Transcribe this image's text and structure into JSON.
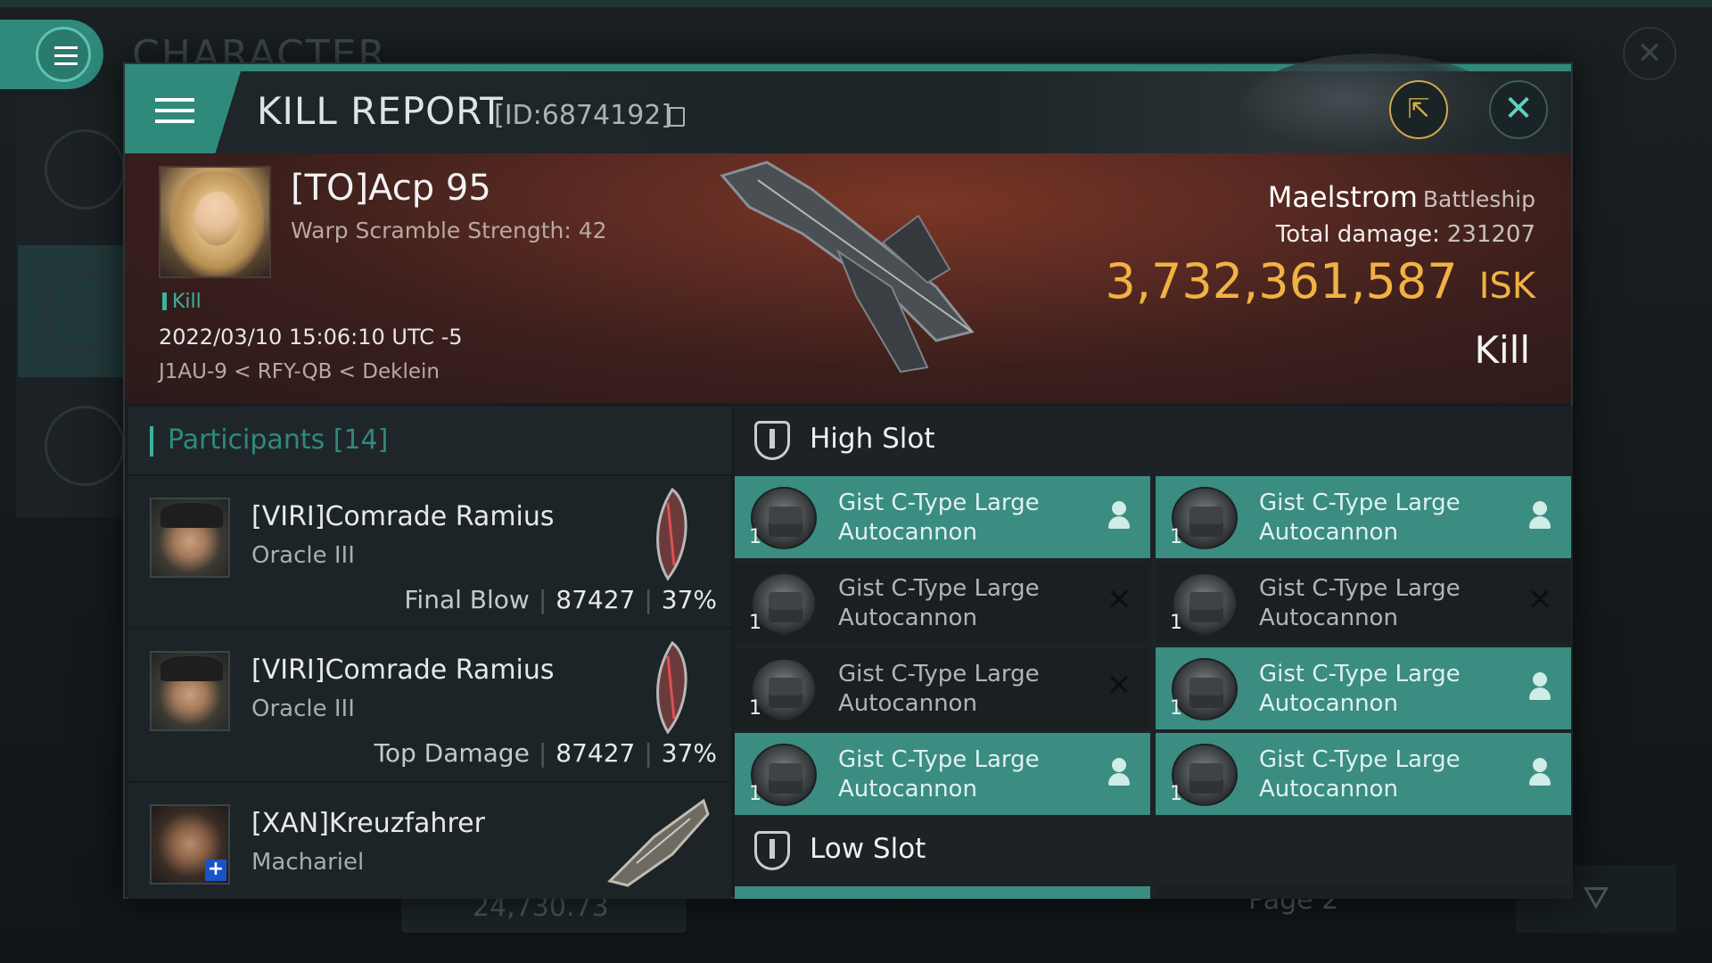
{
  "background": {
    "title": "CHARACTER",
    "footer_value": "24,730.73",
    "page_label": "Page 2"
  },
  "header": {
    "title": "KILL REPORT",
    "report_id": "[ID:6874192]"
  },
  "victim": {
    "name": "[TO]Acp 95",
    "subtitle": "Warp Scramble Strength: 42",
    "tag": "Kill",
    "datetime": "2022/03/10 15:06:10 UTC -5",
    "location": "J1AU-9 < RFY-QB < Deklein",
    "ship_name": "Maelstrom",
    "ship_class": "Battleship",
    "total_damage_label": "Total damage:",
    "total_damage": "231207",
    "isk_value": "3,732,361,587",
    "isk_unit": "ISK",
    "result": "Kill"
  },
  "participants": {
    "title": "Participants [14]",
    "rows": [
      {
        "name": "[VIRI]Comrade Ramius",
        "ship": "Oracle III",
        "role": "Final Blow",
        "damage": "87427",
        "percent": "37%"
      },
      {
        "name": "[VIRI]Comrade Ramius",
        "ship": "Oracle III",
        "role": "Top Damage",
        "damage": "87427",
        "percent": "37%"
      },
      {
        "name": "[XAN]Kreuzfahrer",
        "ship": "Machariel"
      }
    ]
  },
  "high_slot": {
    "title": "High Slot",
    "modules": [
      {
        "name": "Gist C-Type Large Autocannon",
        "qty": "1",
        "status": "dropped"
      },
      {
        "name": "Gist C-Type Large Autocannon",
        "qty": "1",
        "status": "dropped"
      },
      {
        "name": "Gist C-Type Large Autocannon",
        "qty": "1",
        "status": "destroyed"
      },
      {
        "name": "Gist C-Type Large Autocannon",
        "qty": "1",
        "status": "destroyed"
      },
      {
        "name": "Gist C-Type Large Autocannon",
        "qty": "1",
        "status": "destroyed"
      },
      {
        "name": "Gist C-Type Large Autocannon",
        "qty": "1",
        "status": "dropped"
      },
      {
        "name": "Gist C-Type Large Autocannon",
        "qty": "1",
        "status": "dropped"
      },
      {
        "name": "Gist C-Type Large Autocannon",
        "qty": "1",
        "status": "dropped"
      }
    ]
  },
  "low_slot": {
    "title": "Low Slot"
  },
  "icons": {
    "menu": "hamburger-icon",
    "share": "share-icon",
    "close": "close-icon",
    "copy": "copy-icon",
    "slot": "shield-slot-icon",
    "dropped": "person-icon",
    "destroyed": "x-icon"
  },
  "colors": {
    "accent": "#2f8a7c",
    "isk": "#f1b244",
    "dropped_bg": "#3b8c81"
  }
}
